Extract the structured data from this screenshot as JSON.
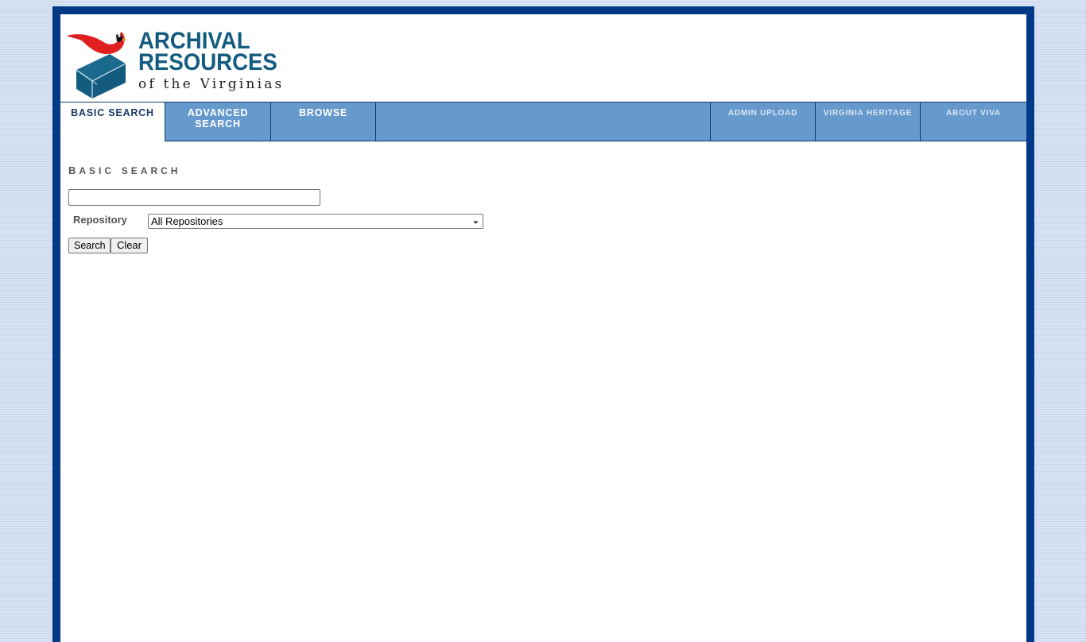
{
  "logo": {
    "line1": "ARCHIVAL",
    "line2": "RESOURCES",
    "line3": "of the Virginias",
    "colors": {
      "text": "#135c80",
      "box": "#135c80",
      "bird": "#e02020"
    }
  },
  "nav": {
    "main_tabs": [
      {
        "label": "Basic Search",
        "active": true
      },
      {
        "label": "Advanced Search",
        "active": false
      },
      {
        "label": "Browse",
        "active": false
      }
    ],
    "util_tabs": [
      {
        "label": "Admin Upload"
      },
      {
        "label": "Virginia Heritage"
      },
      {
        "label": "About VIVA"
      }
    ],
    "colors": {
      "bar": "#6699cc",
      "frame": "#003a86"
    }
  },
  "main": {
    "title_first": "B",
    "title_rest": "asic search",
    "search": {
      "value": "",
      "placeholder": ""
    },
    "repository_label": "Repository",
    "repository_selected": "All Repositories",
    "search_button": "Search",
    "clear_button": "Clear"
  }
}
